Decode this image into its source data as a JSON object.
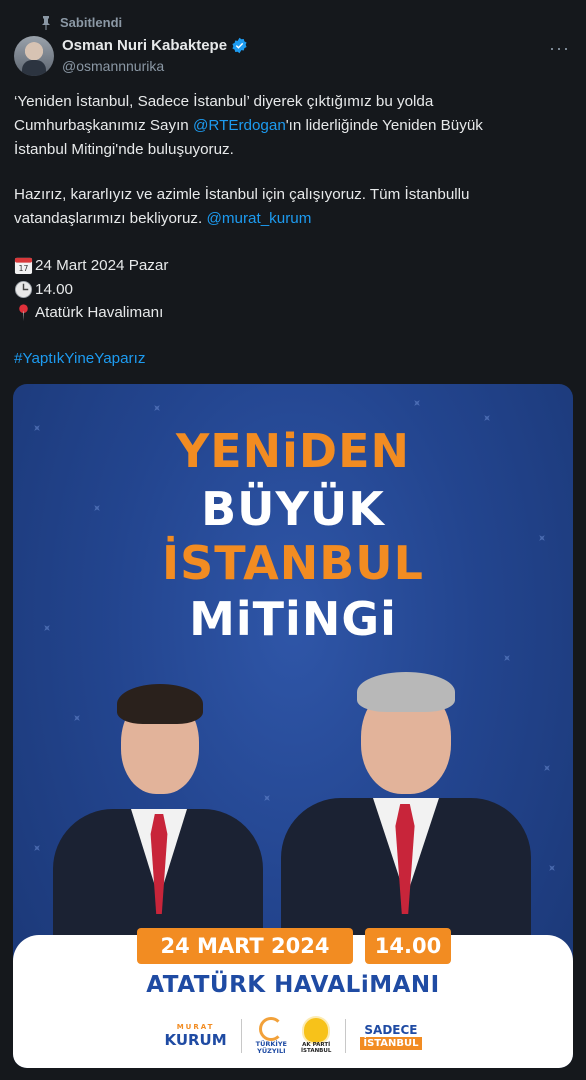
{
  "pinned": {
    "label": "Sabitlendi",
    "icon": "pin-icon"
  },
  "author": {
    "name": "Osman Nuri Kabaktepe",
    "handle": "@osmannnurika",
    "verified": true
  },
  "more_label": "···",
  "body": {
    "line1_a": "‘Yeniden İstanbul, Sadece İstanbul’ diyerek çıktığımız bu yolda",
    "line2_a": "Cumhurbaşkanımız Sayın ",
    "mention1": "@RTErdogan",
    "line2_b": "'ın liderliğinde Yeniden Büyük",
    "line3": "İstanbul Mitingi'nde buluşuyoruz.",
    "line4": "Hazırız, kararlıyız ve azimle İstanbul için çalışıyoruz. Tüm İstanbullu",
    "line5_a": "vatandaşlarımızı bekliyoruz. ",
    "mention2": "@murat_kurum",
    "date": "24 Mart 2024 Pazar",
    "time": "14.00",
    "place": "Atatürk Havalimanı",
    "hashtag": "#YaptıkYineYaparız"
  },
  "poster": {
    "title1": "YENiDEN",
    "title2": "BÜYÜK",
    "title3": "İSTANBUL",
    "title4": "MiTiNGi",
    "date": "24 MART 2024",
    "time": "14.00",
    "venue": "ATATÜRK HAVALiMANI",
    "logos": {
      "kurum_top": "MURAT",
      "kurum_name": "KURUM",
      "turkiye": "TÜRKİYE\nYÜZYILI",
      "ak": "AK PARTİ\nİSTANBUL",
      "sadece1": "SADECE",
      "sadece2": "İSTANBUL"
    }
  },
  "colors": {
    "accent": "#1d9bf0",
    "orange": "#f28c22",
    "navy": "#1f4ba3",
    "bg": "#15181c"
  }
}
